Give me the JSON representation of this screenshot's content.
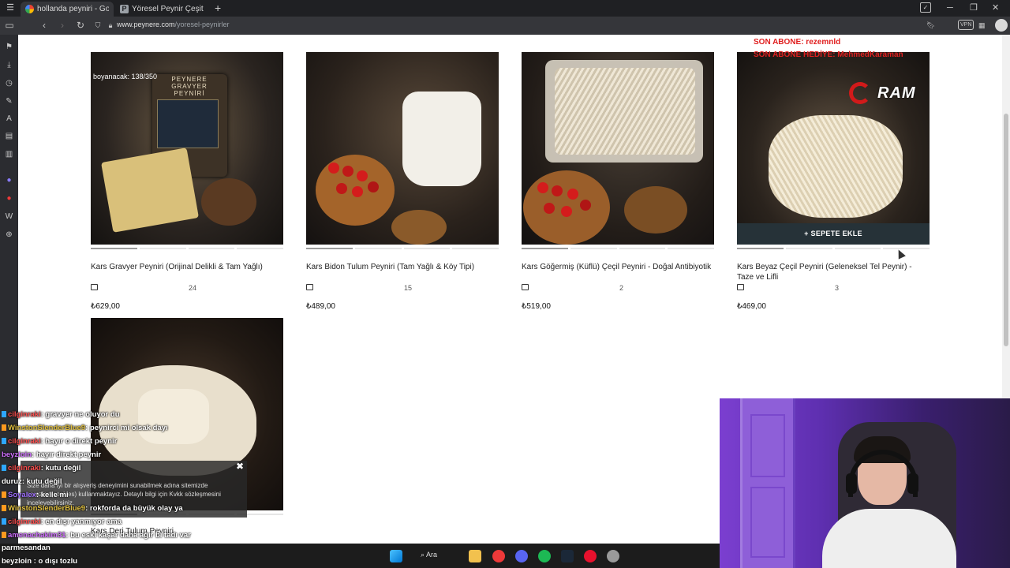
{
  "browser": {
    "tabs": [
      {
        "title": "hollanda peyniri - Google'd",
        "active": true
      },
      {
        "title": "Yöresel Peynir Çeşitleri ve Fi",
        "active": false
      }
    ],
    "url_host": "www.peynere.com",
    "url_path": "/yoresel-peynirler",
    "vpn_label": "VPN"
  },
  "products": [
    {
      "name": "Kars Gravyer Peyniri (Orijinal Delikli & Tam Yağlı)",
      "comments": "24",
      "price": "₺629,00",
      "image_text": "PEYNERE GRAVYER PEYNİRİ"
    },
    {
      "name": "Kars Bidon Tulum Peyniri (Tam Yağlı & Köy Tipi)",
      "comments": "15",
      "price": "₺489,00"
    },
    {
      "name": "Kars Göğermiş (Küflü) Çeçil Peyniri - Doğal Antibiyotik",
      "comments": "2",
      "price": "₺519,00"
    },
    {
      "name": "Kars Beyaz Çeçil Peyniri (Geleneksel Tel Peynir) - Taze ve Lifli",
      "comments": "3",
      "price": "₺469,00",
      "cart_button": "+ SEPETE EKLE"
    },
    {
      "name": "Kars Deri Tulum Peyniri"
    }
  ],
  "overlay": {
    "boyanacak": "boyanacak: 138/350",
    "son_abone": "SON ABONE: rezemnld",
    "son_abone_hediye": "SON ABONE HEDİYE: MehmedKaraman",
    "logo_text": "RAM"
  },
  "cookie": {
    "line1": "Size daha iyi bir alışveriş deneyimini sunabilmek adına sitemizde",
    "line2": "çerezler (cookies) kullanmaktayız. Detaylı bilgi için Kvkk sözleşmesini",
    "line3": "inceleyebilirsiniz."
  },
  "chat": [
    {
      "user": "cilginraki",
      "msg": ": gravyer ne oluyor du",
      "color": "#ff5050"
    },
    {
      "user": "WinstonSlenderBlue9",
      "msg": ": peynirci mi olsak dayı",
      "color": "#e0c040"
    },
    {
      "user": "cilginraki",
      "msg": ": hayır o direkt peynir",
      "color": "#ff5050"
    },
    {
      "user": "beyzloin",
      "msg": ": hayır direkt peynir",
      "color": "#d070ff"
    },
    {
      "user": "cilginraki",
      "msg": ": kutu değil",
      "color": "#ff5050"
    },
    {
      "user": "duruz",
      "msg": ": kutu değil",
      "color": "#ffffff"
    },
    {
      "user": "Soyalex",
      "msg": ": kelle mi",
      "color": "#a070ff"
    },
    {
      "user": "WinstonSlenderBlue9",
      "msg": ": rokforda da büyük olay ya",
      "color": "#e0c040"
    },
    {
      "user": "cilginraki",
      "msg": ": en dışı yanmıyor ama",
      "color": "#ff5050"
    },
    {
      "user": "amenachakim31",
      "msg": ": bu eski kaşar daha ağır bi tadı var",
      "color": "#d070ff"
    }
  ],
  "chat_bottom": [
    {
      "text": "parmesandan"
    },
    {
      "text": "beyzloin : o dışı tozlu"
    }
  ],
  "taskbar": {
    "search_label": "Ara"
  }
}
